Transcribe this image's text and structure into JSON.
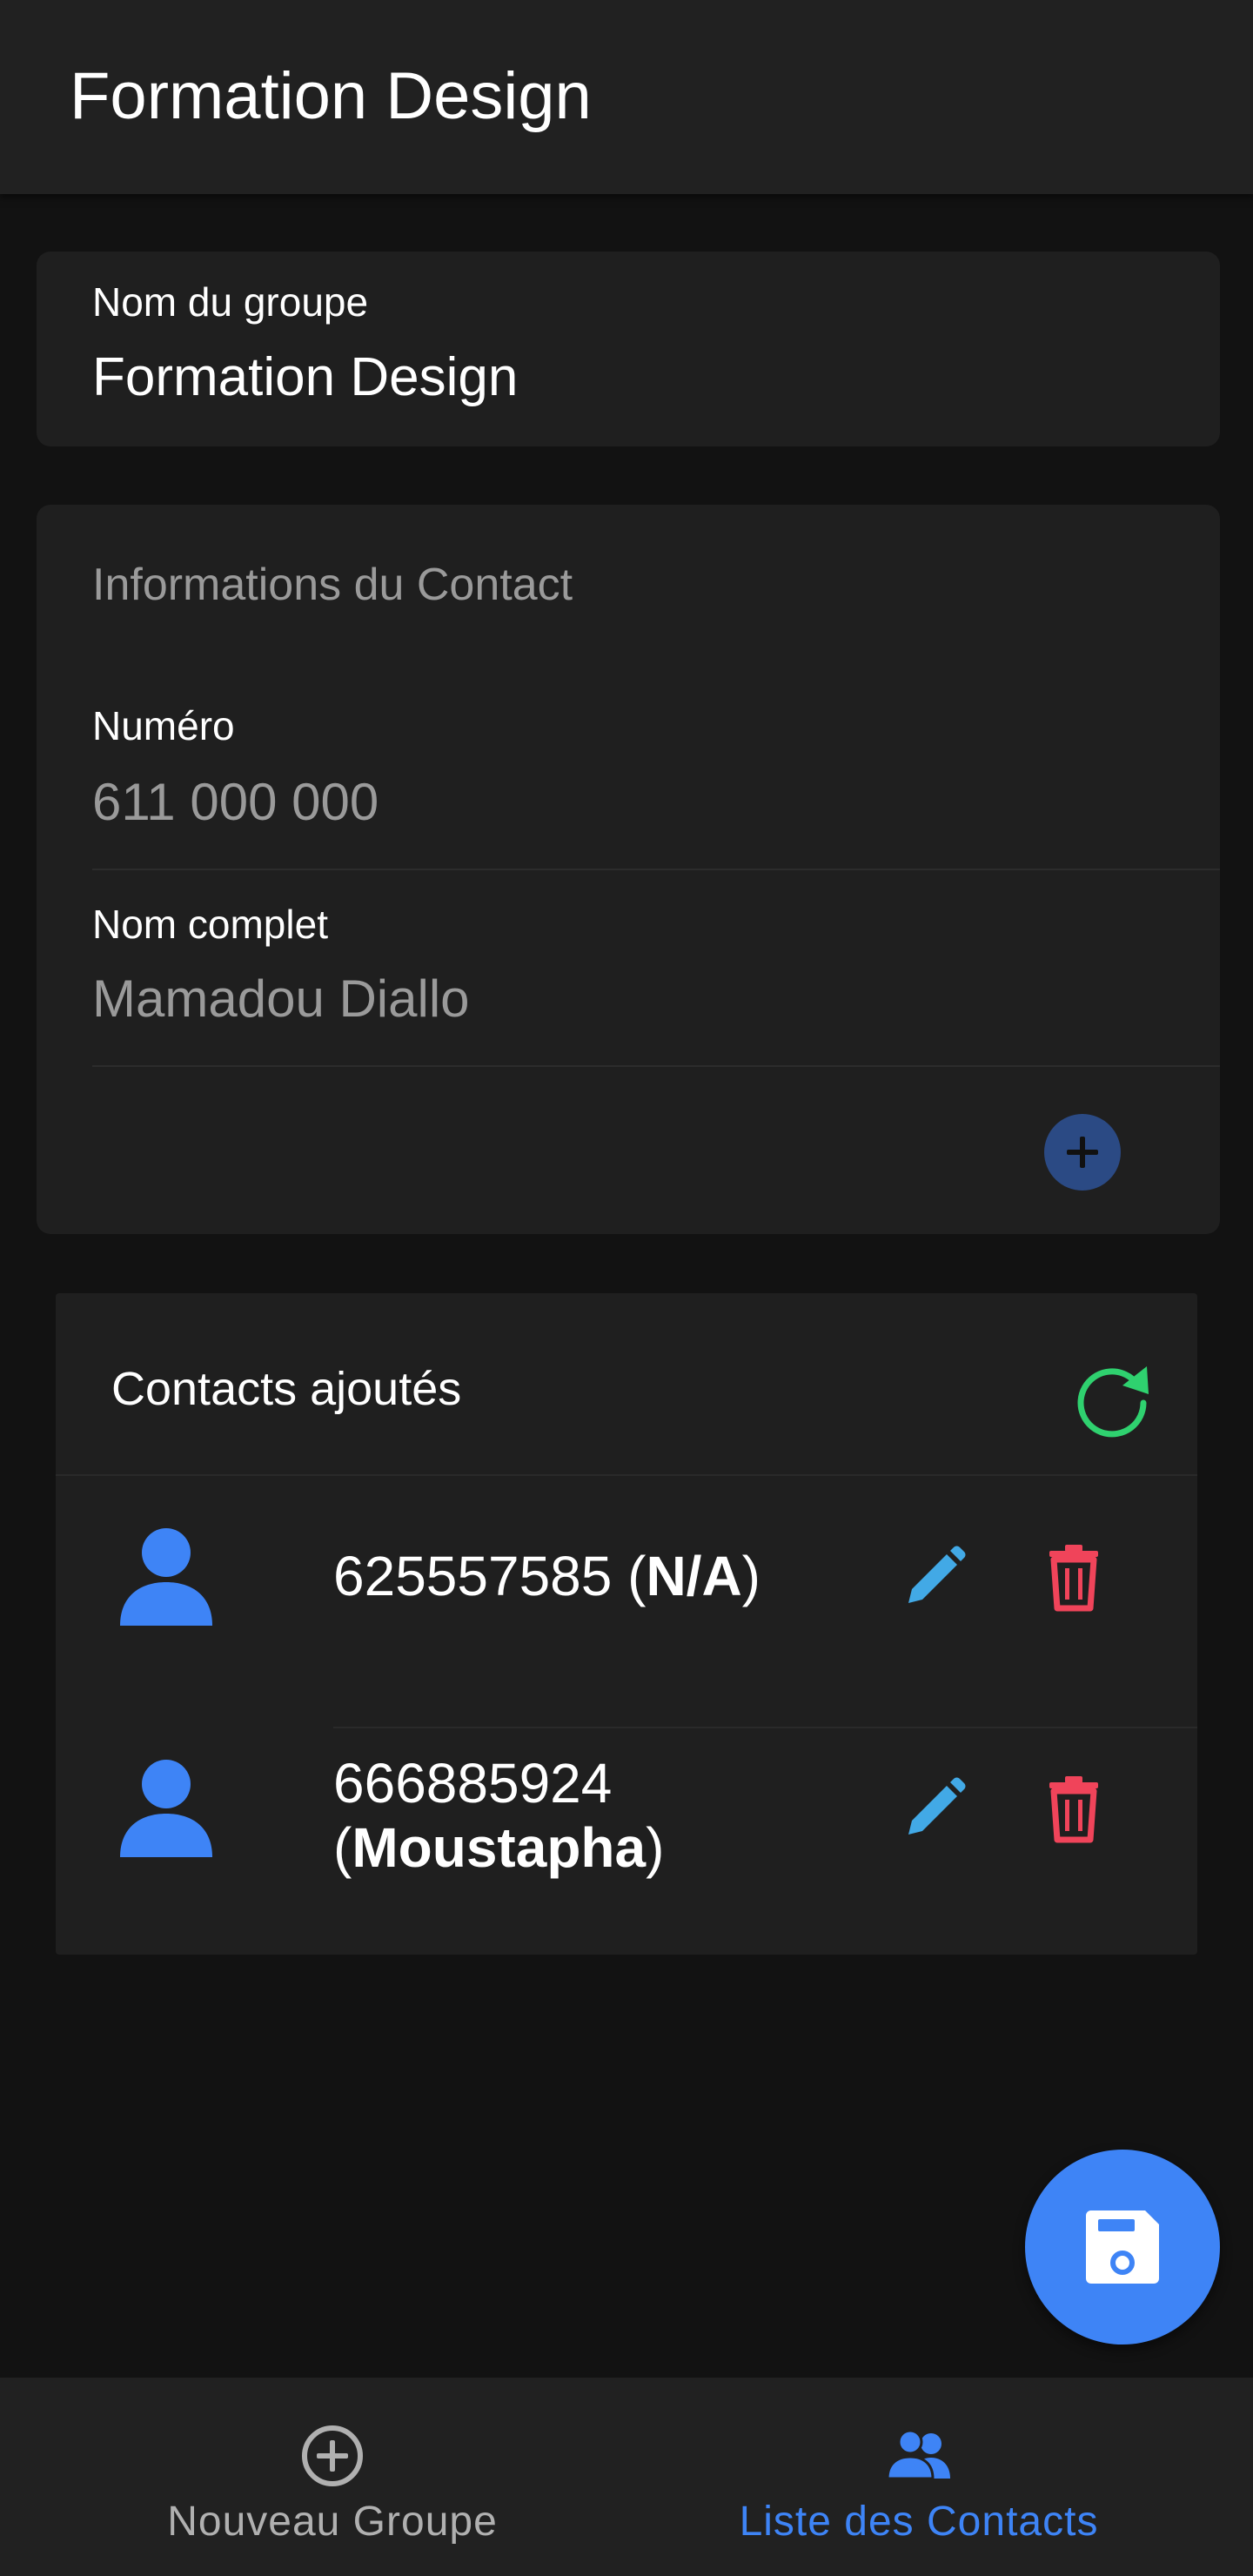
{
  "appbar": {
    "title": "Formation Design"
  },
  "group": {
    "label": "Nom du groupe",
    "value": "Formation Design"
  },
  "contact_form": {
    "title": "Informations du Contact",
    "number_label": "Numéro",
    "number_placeholder": "611 000 000",
    "name_label": "Nom complet",
    "name_placeholder": "Mamadou Diallo",
    "add_icon": "plus-icon"
  },
  "contacts_list": {
    "title": "Contacts ajoutés",
    "refresh_icon": "refresh-icon",
    "items": [
      {
        "number": "625557585",
        "name": "N/A"
      },
      {
        "number": "666885924",
        "name": "Moustapha"
      }
    ]
  },
  "fab": {
    "icon": "save-icon"
  },
  "bottom_nav": {
    "items": [
      {
        "label": "Nouveau Groupe",
        "icon": "add-circle-icon",
        "active": false
      },
      {
        "label": "Liste des Contacts",
        "icon": "contacts-icon",
        "active": true
      }
    ]
  },
  "colors": {
    "accent": "#3e84f6",
    "edit": "#42a9e6",
    "delete": "#f0445a",
    "refresh": "#2fd16f",
    "inactive": "#b0b0b0"
  }
}
